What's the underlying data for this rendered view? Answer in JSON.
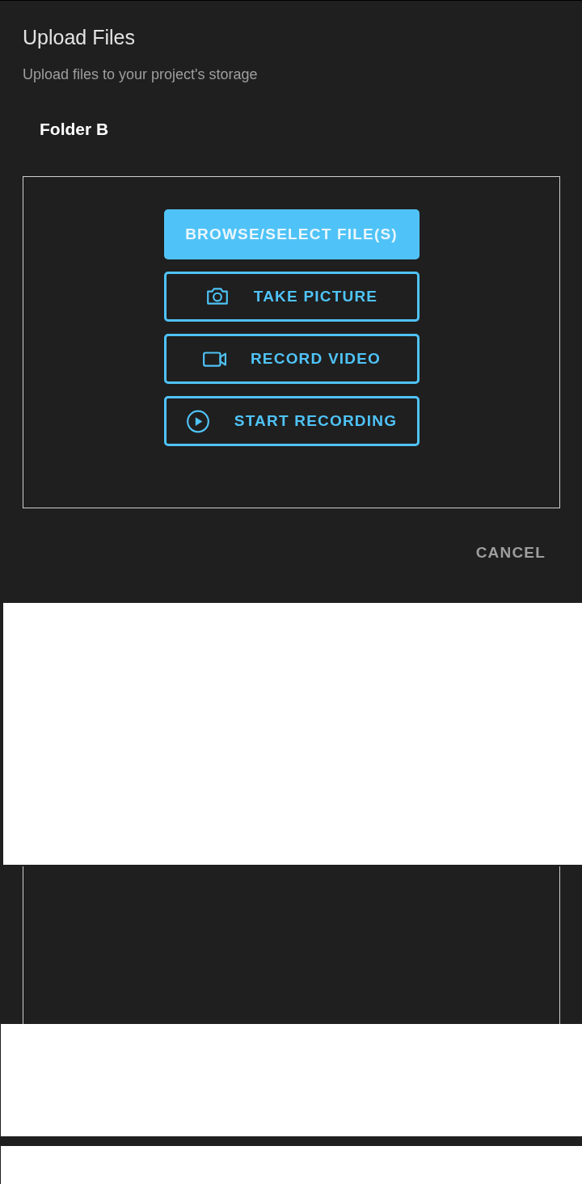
{
  "dialog": {
    "title": "Upload Files",
    "subtitle": "Upload files to your project's storage",
    "folder": "Folder B",
    "buttons": [
      {
        "kind": "filled",
        "label": "BROWSE/SELECT FILE(S)"
      },
      {
        "kind": "camera",
        "label": "TAKE PICTURE"
      },
      {
        "kind": "video",
        "label": "RECORD VIDEO"
      },
      {
        "kind": "play",
        "label": "START RECORDING"
      }
    ],
    "cancel": "CANCEL"
  }
}
